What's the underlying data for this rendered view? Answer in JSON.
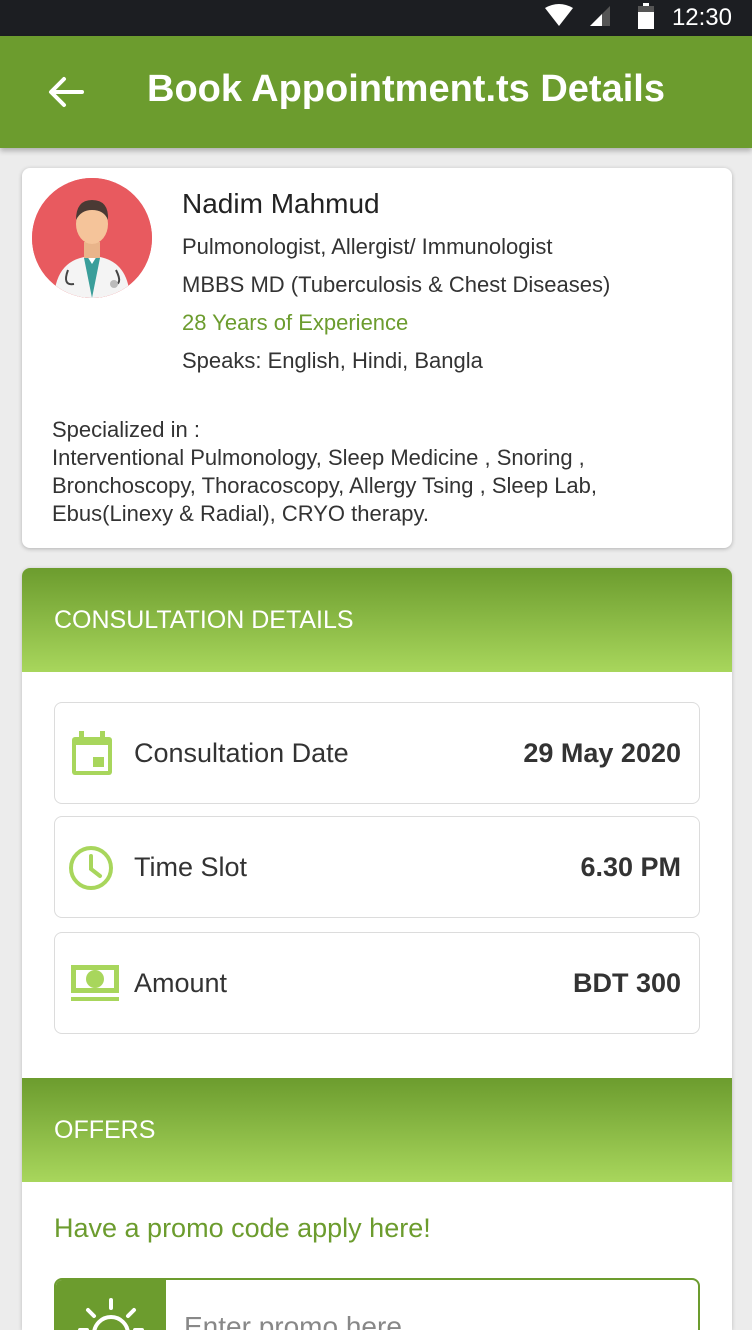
{
  "status_bar": {
    "time": "12:30",
    "icons": [
      "wifi-icon",
      "signal-icon",
      "battery-icon"
    ]
  },
  "app_bar": {
    "title": "Book Appointment.ts Details",
    "back_icon": "arrow-left-icon"
  },
  "doctor": {
    "name": "Nadim Mahmud",
    "specialty": "Pulmonologist, Allergist/ Immunologist",
    "degree": "MBBS MD (Tuberculosis & Chest Diseases)",
    "experience": "28 Years of Experience",
    "languages": "Speaks: English, Hindi, Bangla",
    "specialized_label": "Specialized in :",
    "specialized_in": "Interventional Pulmonology, Sleep Medicine , Snoring , Bronchoscopy, Thoracoscopy, Allergy Tsing , Sleep Lab, Ebus(Linexy & Radial), CRYO therapy."
  },
  "consultation": {
    "header": "CONSULTATION DETAILS",
    "rows": [
      {
        "icon": "calendar-icon",
        "label": "Consultation Date",
        "value": "29 May 2020"
      },
      {
        "icon": "clock-icon",
        "label": "Time Slot",
        "value": "6.30 PM"
      },
      {
        "icon": "money-icon",
        "label": "Amount",
        "value": "BDT 300"
      }
    ]
  },
  "offers": {
    "header": "OFFERS",
    "promo_hint": "Have a promo code apply here!",
    "promo_placeholder": "Enter promo here",
    "promo_value": "",
    "promo_icon": "sun-icon"
  },
  "colors": {
    "primary": "#6c9c2e",
    "accent_light": "#a8d65c",
    "avatar_bg": "#e85a5f"
  }
}
